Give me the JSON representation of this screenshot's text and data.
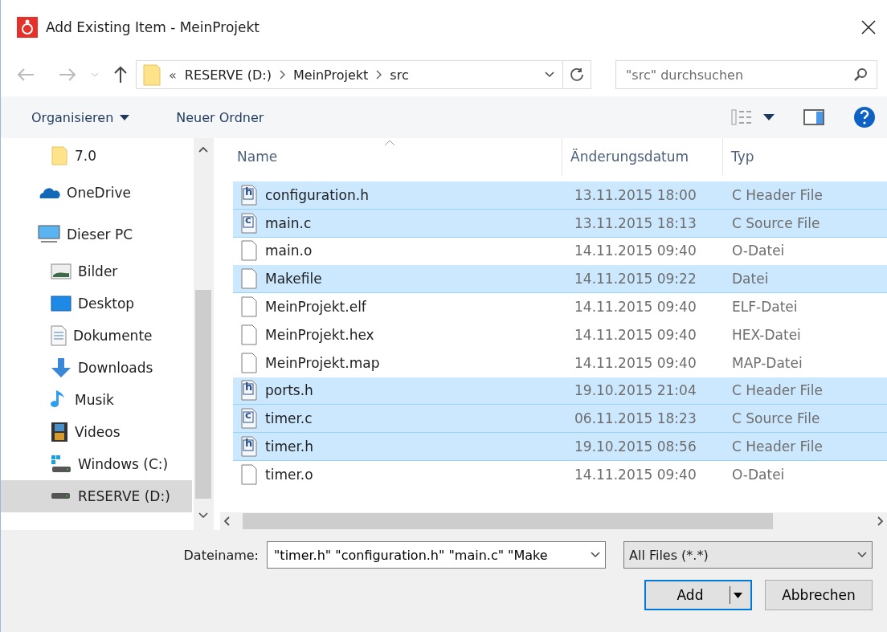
{
  "window": {
    "title": "Add Existing Item - MeinProjekt"
  },
  "address": {
    "overflow": "«",
    "crumbs": [
      "RESERVE (D:)",
      "MeinProjekt",
      "src"
    ]
  },
  "search": {
    "placeholder": "\"src\" durchsuchen"
  },
  "toolbar": {
    "organize": "Organisieren",
    "new_folder": "Neuer Ordner"
  },
  "sidebar": {
    "items": [
      {
        "children": [
          {
            "label": "7.0",
            "kind": "folder",
            "selected": false
          }
        ]
      },
      {
        "label": "OneDrive",
        "kind": "cloud",
        "selected": false
      },
      {
        "label": "Dieser PC",
        "kind": "pc",
        "selected": false,
        "children": [
          {
            "label": "Bilder",
            "kind": "pictures",
            "selected": false
          },
          {
            "label": "Desktop",
            "kind": "desktop",
            "selected": false
          },
          {
            "label": "Dokumente",
            "kind": "documents",
            "selected": false
          },
          {
            "label": "Downloads",
            "kind": "downloads",
            "selected": false
          },
          {
            "label": "Musik",
            "kind": "music",
            "selected": false
          },
          {
            "label": "Videos",
            "kind": "videos",
            "selected": false
          },
          {
            "label": "Windows (C:)",
            "kind": "windows-drive",
            "selected": false
          },
          {
            "label": "RESERVE (D:)",
            "kind": "drive",
            "selected": true
          }
        ]
      }
    ]
  },
  "table": {
    "columns": [
      "Name",
      "Änderungsdatum",
      "Typ"
    ],
    "rows": [
      {
        "name": "configuration.h",
        "badge": "h",
        "date": "13.11.2015 18:00",
        "type": "C Header File",
        "selected": true
      },
      {
        "name": "main.c",
        "badge": "c",
        "date": "13.11.2015 18:13",
        "type": "C Source File",
        "selected": true
      },
      {
        "name": "main.o",
        "date": "14.11.2015 09:40",
        "type": "O-Datei",
        "selected": false
      },
      {
        "name": "Makefile",
        "date": "14.11.2015 09:22",
        "type": "Datei",
        "selected": true
      },
      {
        "name": "MeinProjekt.elf",
        "date": "14.11.2015 09:40",
        "type": "ELF-Datei",
        "selected": false
      },
      {
        "name": "MeinProjekt.hex",
        "date": "14.11.2015 09:40",
        "type": "HEX-Datei",
        "selected": false
      },
      {
        "name": "MeinProjekt.map",
        "date": "14.11.2015 09:40",
        "type": "MAP-Datei",
        "selected": false
      },
      {
        "name": "ports.h",
        "badge": "h",
        "date": "19.10.2015 21:04",
        "type": "C Header File",
        "selected": true
      },
      {
        "name": "timer.c",
        "badge": "c",
        "date": "06.11.2015 18:23",
        "type": "C Source File",
        "selected": true
      },
      {
        "name": "timer.h",
        "badge": "h",
        "date": "19.10.2015 08:56",
        "type": "C Header File",
        "selected": true
      },
      {
        "name": "timer.o",
        "date": "14.11.2015 09:40",
        "type": "O-Datei",
        "selected": false
      }
    ]
  },
  "footer": {
    "filename_label": "Dateiname:",
    "filename": "\"timer.h\" \"configuration.h\" \"main.c\" \"Make",
    "filter": "All Files (*.*)",
    "buttons": [
      {
        "label": "Add",
        "kind": "split"
      },
      {
        "label": "Abbrechen",
        "kind": "plain"
      }
    ]
  }
}
